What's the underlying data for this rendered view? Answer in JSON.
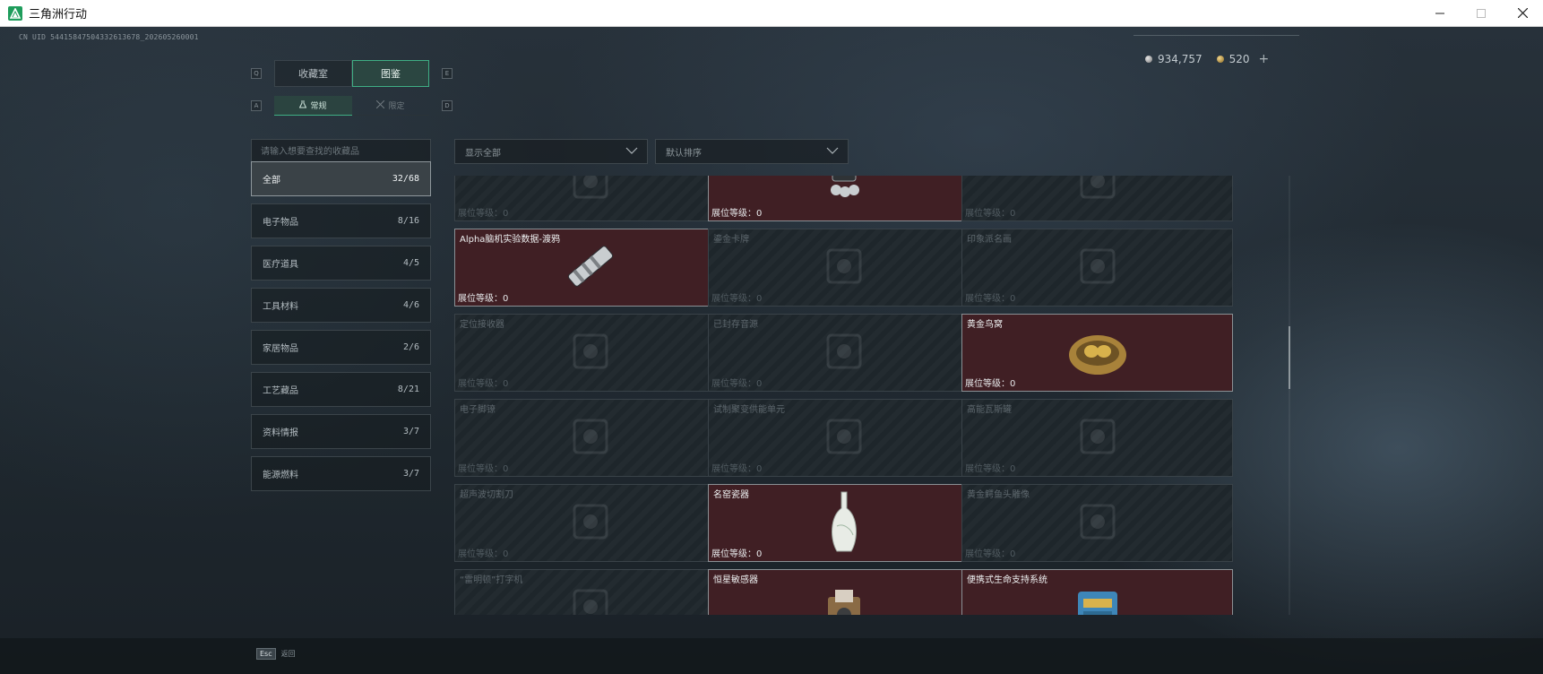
{
  "window": {
    "title": "三角洲行动",
    "minimize_icon": "minimize-icon",
    "maximize_icon": "maximize-icon",
    "close_icon": "close-icon"
  },
  "uid": "CN UID 544158475043326136​78_202605260001",
  "currency": {
    "silver": "934,757",
    "gold": "520",
    "plus": "+"
  },
  "tabs": {
    "left_key": "Q",
    "right_key": "E",
    "items": [
      {
        "label": "收藏室",
        "active": false
      },
      {
        "label": "图鉴",
        "active": true
      }
    ]
  },
  "subtabs": {
    "left_key": "A",
    "right_key": "D",
    "items": [
      {
        "label": "常规",
        "icon": "flask-icon",
        "active": true
      },
      {
        "label": "限定",
        "icon": "crossed-swords-icon",
        "active": false
      }
    ]
  },
  "search": {
    "placeholder": "请输入想要查找的收藏品",
    "value": ""
  },
  "filters": {
    "show": "显示全部",
    "sort": "默认排序"
  },
  "categories": [
    {
      "label": "全部",
      "count": "32/68",
      "active": true
    },
    {
      "label": "电子物品",
      "count": "8/16",
      "active": false
    },
    {
      "label": "医疗道具",
      "count": "4/5",
      "active": false
    },
    {
      "label": "工具材料",
      "count": "4/6",
      "active": false
    },
    {
      "label": "家居物品",
      "count": "2/6",
      "active": false
    },
    {
      "label": "工艺藏品",
      "count": "8/21",
      "active": false
    },
    {
      "label": "资料情报",
      "count": "3/7",
      "active": false
    },
    {
      "label": "能源燃料",
      "count": "3/7",
      "active": false
    }
  ],
  "level_label": "展位等级：0",
  "items": [
    {
      "name": "",
      "owned": false,
      "icon": "gear-ring-icon"
    },
    {
      "name": "",
      "owned": true,
      "icon": "camera-device-icon"
    },
    {
      "name": "",
      "owned": false,
      "icon": "box-icon"
    },
    {
      "name": "Alpha脑机实验数据-渡鸦",
      "owned": true,
      "icon": "data-cylinder-icon"
    },
    {
      "name": "鎏金卡牌",
      "owned": false,
      "icon": "card-icon"
    },
    {
      "name": "印象派名画",
      "owned": false,
      "icon": "painting-icon"
    },
    {
      "name": "定位接收器",
      "owned": false,
      "icon": "receiver-icon"
    },
    {
      "name": "已封存音源",
      "owned": false,
      "icon": "audio-device-icon"
    },
    {
      "name": "黄金鸟窝",
      "owned": true,
      "icon": "golden-nest-icon"
    },
    {
      "name": "电子脚镣",
      "owned": false,
      "icon": "ankle-monitor-icon"
    },
    {
      "name": "试制聚变供能单元",
      "owned": false,
      "icon": "power-unit-icon"
    },
    {
      "name": "高能瓦斯罐",
      "owned": false,
      "icon": "gas-canister-icon"
    },
    {
      "name": "超声波切割刀",
      "owned": false,
      "icon": "cutter-icon"
    },
    {
      "name": "名窑瓷器",
      "owned": true,
      "icon": "porcelain-vase-icon"
    },
    {
      "name": "黄金鳄鱼头雕像",
      "owned": false,
      "icon": "statue-icon"
    },
    {
      "name": "“雷明顿”打字机",
      "owned": false,
      "icon": "typewriter-icon"
    },
    {
      "name": "恒星敏感器",
      "owned": true,
      "icon": "star-sensor-icon"
    },
    {
      "name": "便携式生命支持系统",
      "owned": true,
      "icon": "life-support-icon"
    }
  ],
  "footer": {
    "esc_key": "Esc",
    "esc_label": "返回"
  }
}
